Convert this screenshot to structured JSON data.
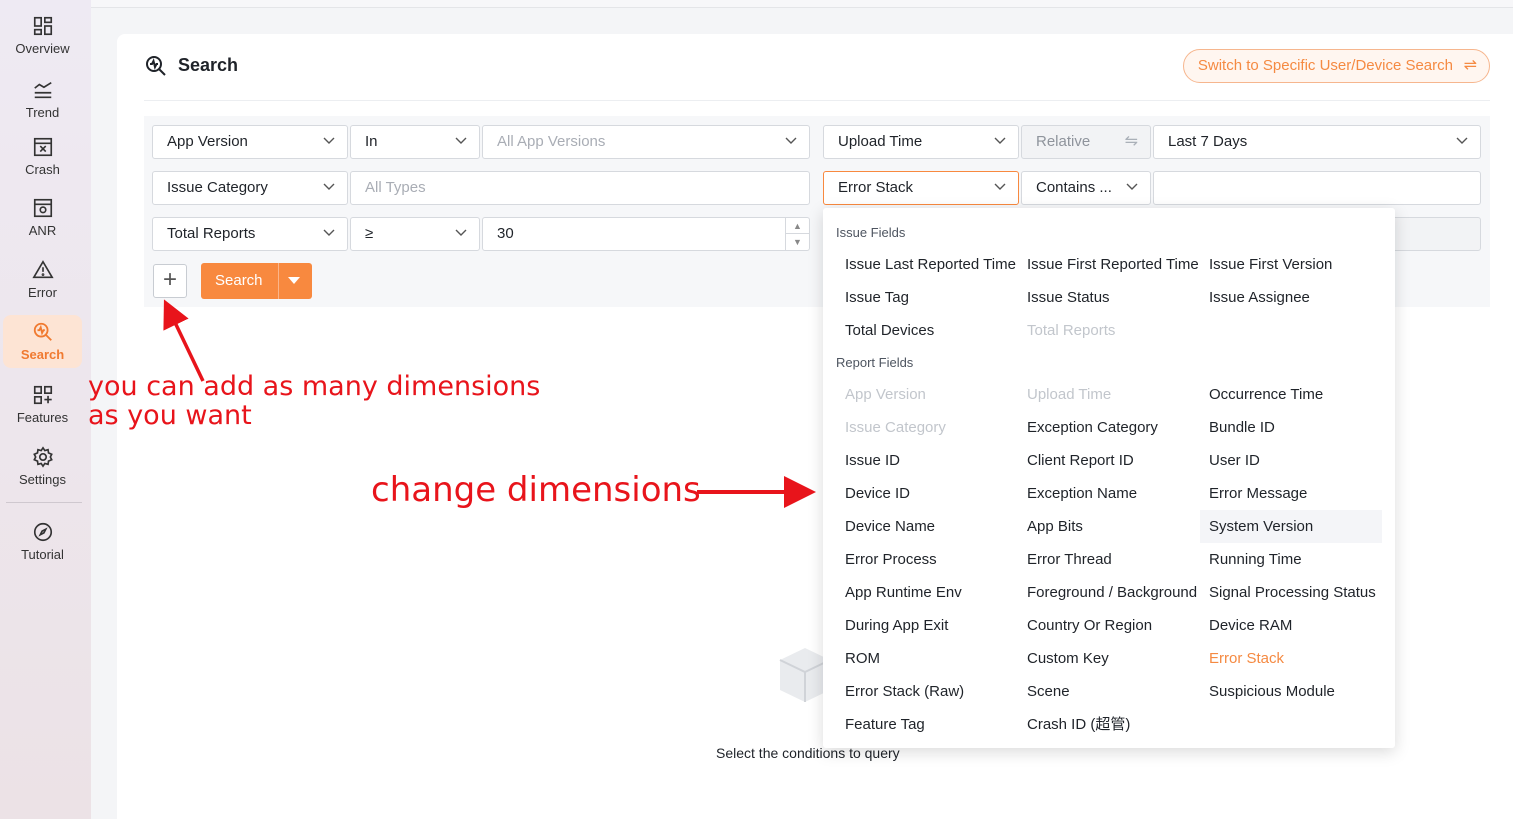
{
  "sidebar": {
    "items": [
      {
        "label": "Overview",
        "icon": "overview-icon"
      },
      {
        "label": "Trend",
        "icon": "trend-icon"
      },
      {
        "label": "Crash",
        "icon": "crash-icon"
      },
      {
        "label": "ANR",
        "icon": "anr-icon"
      },
      {
        "label": "Error",
        "icon": "error-icon"
      },
      {
        "label": "Search",
        "icon": "search-icon",
        "active": true
      },
      {
        "label": "Features",
        "icon": "features-icon"
      },
      {
        "label": "Settings",
        "icon": "gear-icon"
      },
      {
        "label": "Tutorial",
        "icon": "compass-icon"
      }
    ]
  },
  "header": {
    "title": "Search",
    "switch_label": "Switch to Specific User/Device Search",
    "switch_icon": "⇌"
  },
  "filters": {
    "row1": {
      "dimension": "App Version",
      "operator": "In",
      "value_placeholder": "All App Versions"
    },
    "row2": {
      "dimension": "Issue Category",
      "value_placeholder": "All Types"
    },
    "row3": {
      "dimension": "Total Reports",
      "operator": "≥",
      "value": "30"
    },
    "time": {
      "dimension": "Upload Time",
      "mode": "Relative",
      "mode_icon": "⇋",
      "range": "Last 7 Days"
    },
    "stack": {
      "dimension": "Error Stack",
      "operator": "Contains ...",
      "value": ""
    },
    "search_label": "Search",
    "add_label": "+"
  },
  "dropdown": {
    "issue_fields_label": "Issue Fields",
    "issue_fields": [
      [
        "Issue Last Reported Time",
        "Issue First Reported Time",
        "Issue First Version"
      ],
      [
        "Issue Tag",
        "Issue Status",
        "Issue Assignee"
      ],
      [
        "Total Devices",
        "Total Reports",
        ""
      ]
    ],
    "report_fields_label": "Report Fields",
    "report_fields": [
      [
        "App Version",
        "Upload Time",
        "Occurrence Time"
      ],
      [
        "Issue Category",
        "Exception Category",
        "Bundle ID"
      ],
      [
        "Issue ID",
        "Client Report ID",
        "User ID"
      ],
      [
        "Device ID",
        "Exception Name",
        "Error Message"
      ],
      [
        "Device Name",
        "App Bits",
        "System Version"
      ],
      [
        "Error Process",
        "Error Thread",
        "Running Time"
      ],
      [
        "App Runtime Env",
        "Foreground / Background",
        "Signal Processing Status"
      ],
      [
        "During App Exit",
        "Country Or Region",
        "Device RAM"
      ],
      [
        "ROM",
        "Custom Key",
        "Error Stack"
      ],
      [
        "Error Stack (Raw)",
        "Scene",
        "Suspicious Module"
      ],
      [
        "Feature Tag",
        "Crash ID (超管)",
        ""
      ]
    ]
  },
  "empty_state": {
    "text": "Select the conditions to query"
  },
  "annotations": {
    "add_line1": "you can add as many dimensions",
    "add_line2": "as you want",
    "change": "change dimensions"
  },
  "colors": {
    "accent": "#f8893f",
    "annotation": "#e8141b",
    "sidebar_active": "#fde4d4"
  }
}
